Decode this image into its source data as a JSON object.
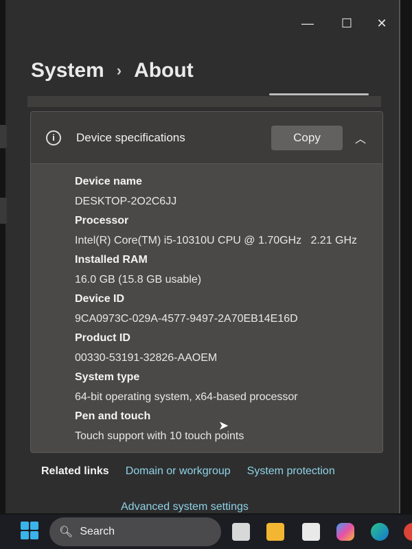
{
  "window": {
    "minimize": "—",
    "maximize": "☐",
    "close": "✕"
  },
  "breadcrumb": {
    "parent": "System",
    "separator": "›",
    "current": "About"
  },
  "card": {
    "title": "Device specifications",
    "copy_label": "Copy",
    "specs": [
      {
        "label": "Device name",
        "value": "DESKTOP-2O2C6JJ"
      },
      {
        "label": "Processor",
        "value": "Intel(R) Core(TM) i5-10310U CPU @ 1.70GHz   2.21 GHz"
      },
      {
        "label": "Installed RAM",
        "value": "16.0 GB (15.8 GB usable)"
      },
      {
        "label": "Device ID",
        "value": "9CA0973C-029A-4577-9497-2A70EB14E16D"
      },
      {
        "label": "Product ID",
        "value": "00330-53191-32826-AAOEM"
      },
      {
        "label": "System type",
        "value": "64-bit operating system, x64-based processor"
      },
      {
        "label": "Pen and touch",
        "value": "Touch support with 10 touch points"
      }
    ]
  },
  "related": {
    "label": "Related links",
    "links": [
      "Domain or workgroup",
      "System protection",
      "Advanced system settings"
    ]
  },
  "taskbar": {
    "search_label": "Search",
    "icons": [
      "task-view-icon",
      "file-explorer-icon",
      "microsoft-store-icon",
      "copilot-icon",
      "edge-icon",
      "chrome-icon"
    ]
  }
}
